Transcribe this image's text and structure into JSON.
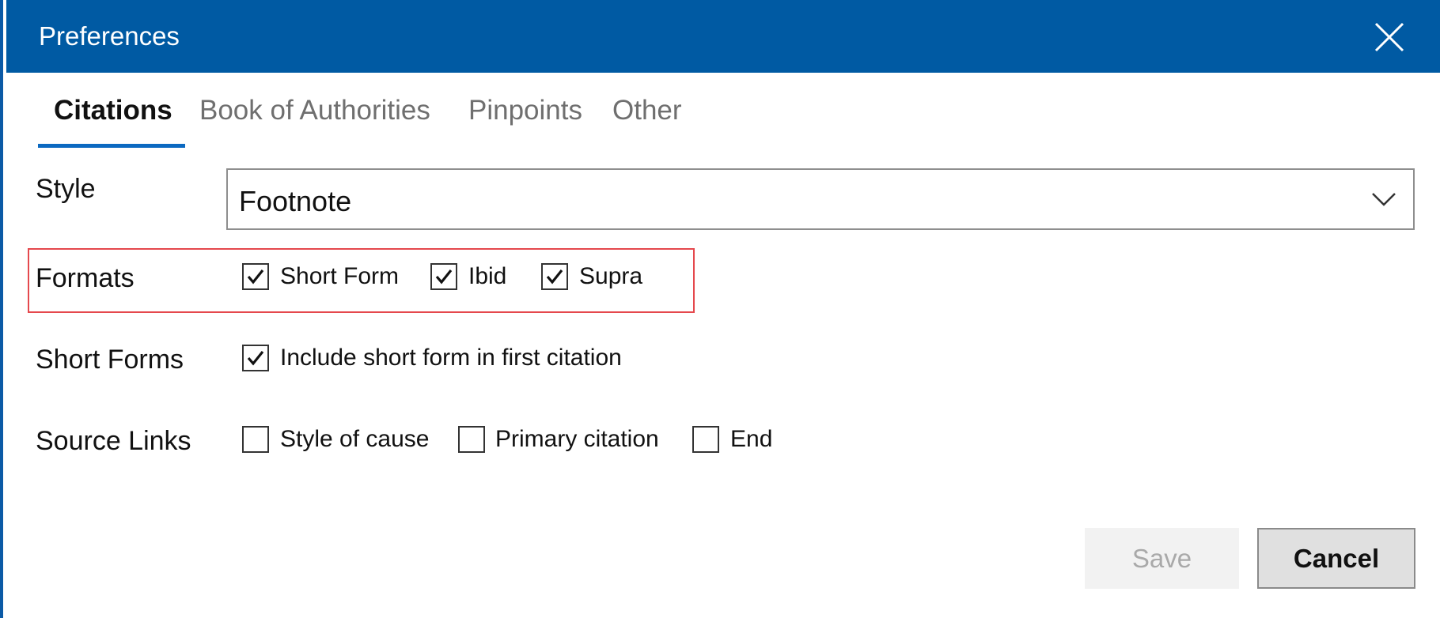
{
  "dialog": {
    "title": "Preferences"
  },
  "tabs": [
    {
      "label": "Citations",
      "active": true
    },
    {
      "label": "Book of Authorities",
      "active": false
    },
    {
      "label": "Pinpoints",
      "active": false
    },
    {
      "label": "Other",
      "active": false
    }
  ],
  "style": {
    "label": "Style",
    "value": "Footnote"
  },
  "formats": {
    "label": "Formats",
    "options": [
      {
        "label": "Short Form",
        "checked": true
      },
      {
        "label": "Ibid",
        "checked": true
      },
      {
        "label": "Supra",
        "checked": true
      }
    ]
  },
  "short_forms": {
    "label": "Short Forms",
    "options": [
      {
        "label": "Include short form in first citation",
        "checked": true
      }
    ]
  },
  "source_links": {
    "label": "Source Links",
    "options": [
      {
        "label": "Style of cause",
        "checked": false
      },
      {
        "label": "Primary citation",
        "checked": false
      },
      {
        "label": "End",
        "checked": false
      }
    ]
  },
  "buttons": {
    "save": "Save",
    "cancel": "Cancel"
  },
  "colors": {
    "titlebar": "#005aa3",
    "accent": "#0b69c1",
    "highlight": "#e5484d"
  },
  "icons": {
    "close": "close-icon",
    "dropdown": "chevron-down-icon",
    "check": "checkmark-icon"
  }
}
